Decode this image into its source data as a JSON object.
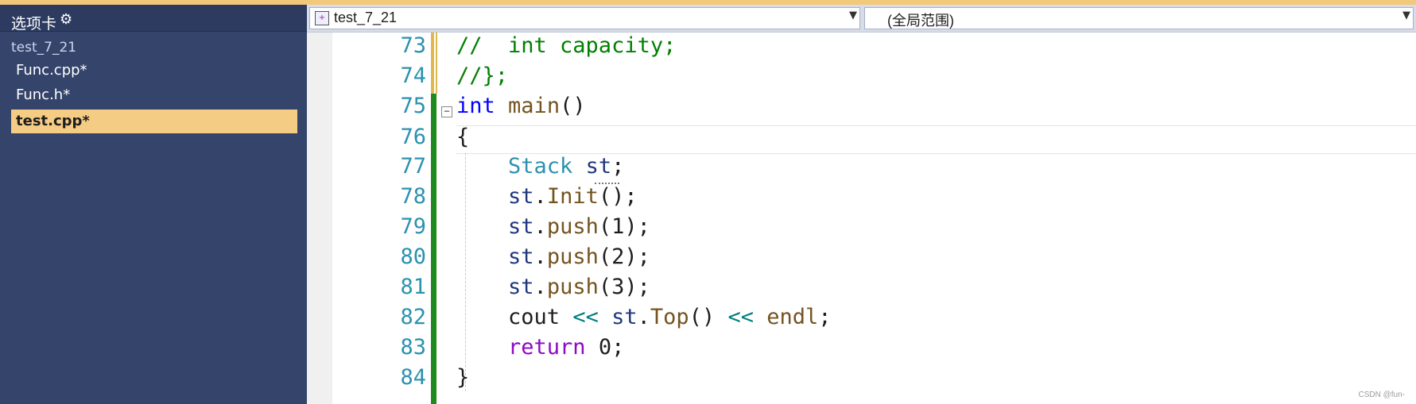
{
  "colors": {
    "sidebar_bg": "#34446b",
    "active_file_bg": "#f5cc84",
    "line_number": "#2b91af",
    "comment": "#008000",
    "keyword": "#0000ff",
    "control_keyword": "#8f08c4",
    "function": "#74531f",
    "type": "#2b91af",
    "variable": "#1f377f",
    "operator": "#008080",
    "change_saved": "#1e8a1e",
    "change_unsaved": "#e0b94a"
  },
  "sidebar": {
    "title": "选项卡",
    "settings_icon": "gear-icon",
    "project": "test_7_21",
    "files": [
      {
        "label": "Func.cpp*",
        "active": false
      },
      {
        "label": "Func.h*",
        "active": false
      },
      {
        "label": "test.cpp*",
        "active": true
      }
    ]
  },
  "toolbar": {
    "project_combo": "test_7_21",
    "scope_combo": "(全局范围)",
    "project_icon": "project-file-icon",
    "dropdown_icon": "chevron-down-icon"
  },
  "editor": {
    "lines": [
      {
        "number": "73",
        "tokens": [
          {
            "t": "//  int capacity;",
            "c": "comment"
          }
        ]
      },
      {
        "number": "74",
        "tokens": [
          {
            "t": "//};",
            "c": "comment"
          }
        ]
      },
      {
        "number": "75",
        "tokens": [
          {
            "t": "int",
            "c": "keyword"
          },
          {
            "t": " ",
            "c": "plain"
          },
          {
            "t": "main",
            "c": "function"
          },
          {
            "t": "()",
            "c": "plain"
          }
        ]
      },
      {
        "number": "76",
        "tokens": [
          {
            "t": "{",
            "c": "plain"
          }
        ]
      },
      {
        "number": "77",
        "tokens": [
          {
            "t": "    ",
            "c": "plain"
          },
          {
            "t": "Stack",
            "c": "type"
          },
          {
            "t": " ",
            "c": "plain"
          },
          {
            "t": "st",
            "c": "variable"
          },
          {
            "t": ";",
            "c": "plain"
          }
        ]
      },
      {
        "number": "78",
        "tokens": [
          {
            "t": "    ",
            "c": "plain"
          },
          {
            "t": "st",
            "c": "variable"
          },
          {
            "t": ".",
            "c": "plain"
          },
          {
            "t": "Init",
            "c": "function"
          },
          {
            "t": "();",
            "c": "plain"
          }
        ]
      },
      {
        "number": "79",
        "tokens": [
          {
            "t": "    ",
            "c": "plain"
          },
          {
            "t": "st",
            "c": "variable"
          },
          {
            "t": ".",
            "c": "plain"
          },
          {
            "t": "push",
            "c": "function"
          },
          {
            "t": "(1);",
            "c": "plain"
          }
        ]
      },
      {
        "number": "80",
        "tokens": [
          {
            "t": "    ",
            "c": "plain"
          },
          {
            "t": "st",
            "c": "variable"
          },
          {
            "t": ".",
            "c": "plain"
          },
          {
            "t": "push",
            "c": "function"
          },
          {
            "t": "(2);",
            "c": "plain"
          }
        ]
      },
      {
        "number": "81",
        "tokens": [
          {
            "t": "    ",
            "c": "plain"
          },
          {
            "t": "st",
            "c": "variable"
          },
          {
            "t": ".",
            "c": "plain"
          },
          {
            "t": "push",
            "c": "function"
          },
          {
            "t": "(3);",
            "c": "plain"
          }
        ]
      },
      {
        "number": "82",
        "tokens": [
          {
            "t": "    ",
            "c": "plain"
          },
          {
            "t": "cout",
            "c": "plain"
          },
          {
            "t": " ",
            "c": "plain"
          },
          {
            "t": "<<",
            "c": "operator"
          },
          {
            "t": " ",
            "c": "plain"
          },
          {
            "t": "st",
            "c": "variable"
          },
          {
            "t": ".",
            "c": "plain"
          },
          {
            "t": "Top",
            "c": "function"
          },
          {
            "t": "() ",
            "c": "plain"
          },
          {
            "t": "<<",
            "c": "operator"
          },
          {
            "t": " ",
            "c": "plain"
          },
          {
            "t": "endl",
            "c": "function"
          },
          {
            "t": ";",
            "c": "plain"
          }
        ]
      },
      {
        "number": "83",
        "tokens": [
          {
            "t": "    ",
            "c": "plain"
          },
          {
            "t": "return",
            "c": "control_keyword"
          },
          {
            "t": " 0;",
            "c": "plain"
          }
        ]
      },
      {
        "number": "84",
        "tokens": [
          {
            "t": "}",
            "c": "plain"
          }
        ]
      }
    ],
    "collapse_icon": "collapse-minus-icon"
  },
  "watermark": "CSDN @fun-"
}
